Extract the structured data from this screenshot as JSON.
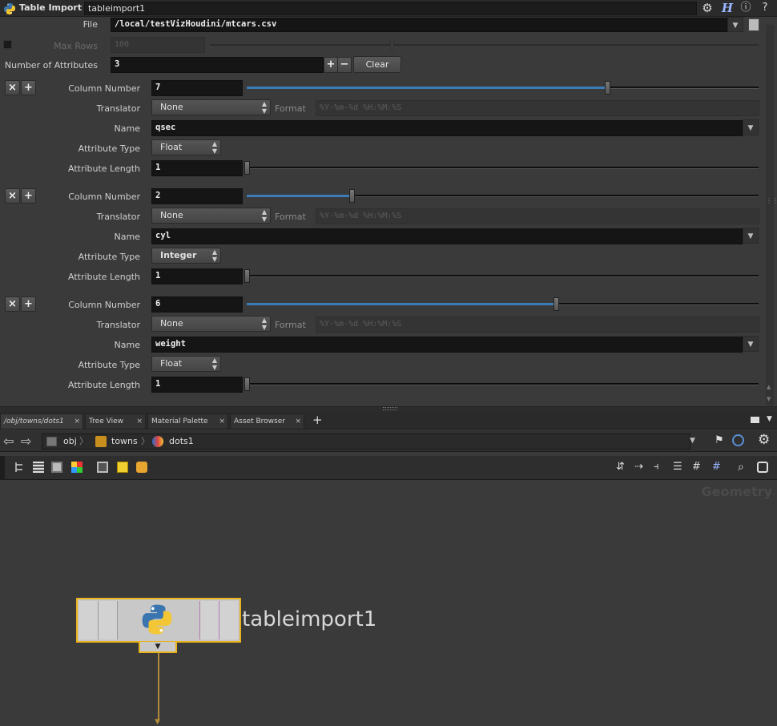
{
  "header": {
    "node_type": "Table Import",
    "node_name": "tableimport1"
  },
  "parms": {
    "file_label": "File",
    "file_value": "/local/testVizHoudini/mtcars.csv",
    "maxrows_label": "Max Rows",
    "maxrows_value": "100",
    "numattr_label": "Number of Attributes",
    "numattr_value": "3",
    "clear_label": "Clear",
    "add_label": "+",
    "remove_label": "−",
    "labels": {
      "column_number": "Column Number",
      "translator": "Translator",
      "format": "Format",
      "name": "Name",
      "attribute_type": "Attribute Type",
      "attribute_length": "Attribute Length"
    },
    "attributes": [
      {
        "column": "7",
        "column_fraction": 0.7,
        "translator": "None",
        "format": "%Y-%m-%d %H:%M:%S",
        "name": "qsec",
        "type": "Float",
        "length": "1"
      },
      {
        "column": "2",
        "column_fraction": 0.2,
        "translator": "None",
        "format": "%Y-%m-%d %H:%M:%S",
        "name": "cyl",
        "type": "Integer",
        "length": "1"
      },
      {
        "column": "6",
        "column_fraction": 0.6,
        "translator": "None",
        "format": "%Y-%m-%d %H:%M:%S",
        "name": "weight",
        "type": "Float",
        "length": "1"
      }
    ]
  },
  "tabs": [
    {
      "label": "/obj/towns/dots1",
      "active": true
    },
    {
      "label": "Tree View",
      "active": false
    },
    {
      "label": "Material Palette",
      "active": false
    },
    {
      "label": "Asset Browser",
      "active": false
    }
  ],
  "path": {
    "crumbs": [
      "obj",
      "towns",
      "dots1"
    ]
  },
  "network": {
    "context_label": "Geometry",
    "node_label": "tableimport1"
  },
  "colors": {
    "node_border": "#e8b21a",
    "slider_fill": "#3d7ab8"
  }
}
